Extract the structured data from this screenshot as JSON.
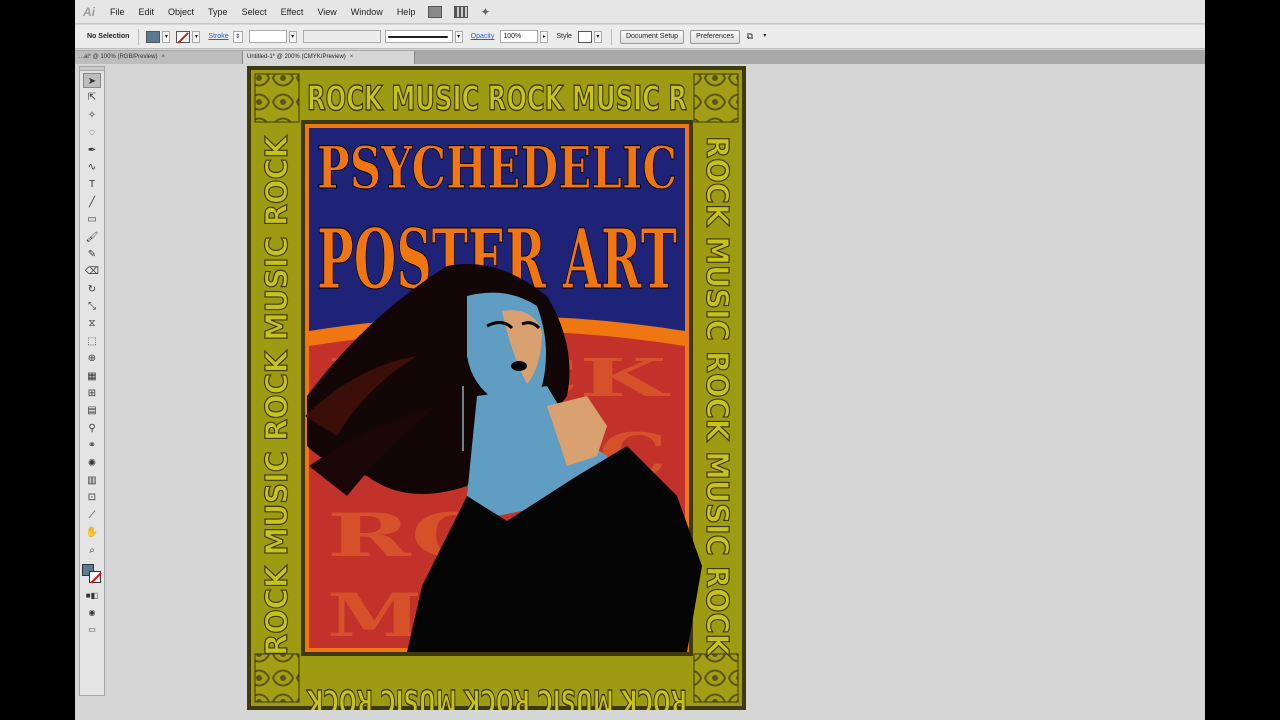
{
  "app": {
    "logo": "Ai"
  },
  "menubar": {
    "items": [
      "File",
      "Edit",
      "Object",
      "Type",
      "Select",
      "Effect",
      "View",
      "Window",
      "Help"
    ]
  },
  "controlbar": {
    "selection": "No Selection",
    "stroke_label": "Stroke",
    "opacity_label": "Opacity",
    "opacity_value": "100%",
    "style_label": "Style",
    "document_setup": "Document Setup",
    "preferences": "Preferences",
    "fill_color": "#5a7a90"
  },
  "tabs": [
    {
      "label": "...ai* @ 100% (RGB/Preview)",
      "close": "×"
    },
    {
      "label": "Untitled-1* @ 200% (CMYK/Preview)",
      "close": "×"
    }
  ],
  "toolbox": {
    "tools": [
      "selection",
      "direct-selection",
      "magic-wand",
      "lasso",
      "pen",
      "curvature",
      "type",
      "line",
      "rectangle",
      "paintbrush",
      "pencil",
      "eraser",
      "rotate",
      "scale",
      "width",
      "free-transform",
      "shape-builder",
      "perspective",
      "mesh",
      "gradient",
      "eyedropper",
      "blend",
      "symbol-sprayer",
      "column-graph",
      "artboard",
      "slice",
      "hand",
      "zoom"
    ]
  },
  "poster": {
    "title_line1": "PSYCHEDELIC",
    "title_line2": "POSTER ART",
    "border_top": "ROCK MUSIC ROCK MUSIC R",
    "border_bottom": "ROCK MUSIC ROCK MUSIC ROCK",
    "border_side": "ROCK MUSIC ROCK MUSIC ROCK",
    "inner_words": [
      "ROCK",
      "MUSIC",
      "ROCK",
      "MUSIC"
    ],
    "colors": {
      "border": "#9e9a12",
      "frame_dark": "#3f3a0b",
      "orange": "#f07612",
      "navy": "#1f2378",
      "red": "#c2312a",
      "skin": "#5f9ec2",
      "skin_light": "#d9a070"
    }
  }
}
